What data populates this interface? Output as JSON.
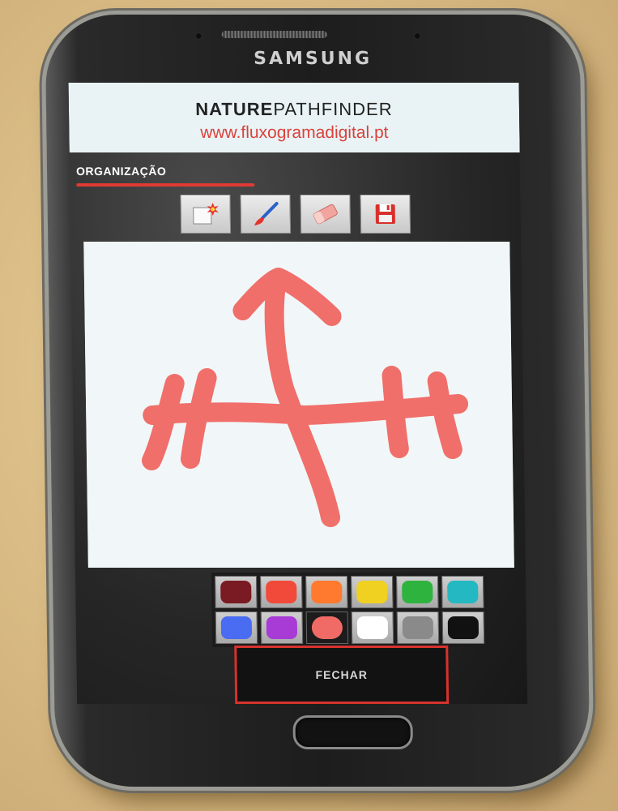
{
  "device": {
    "brand": "SAMSUNG"
  },
  "header": {
    "title_bold": "NATURE",
    "title_rest": "PATHFINDER",
    "url": "www.fluxogramadigital.pt"
  },
  "section": {
    "label": "ORGANIZAÇÃO"
  },
  "toolbar": {
    "tools": [
      {
        "icon": "new-canvas-icon"
      },
      {
        "icon": "brush-icon"
      },
      {
        "icon": "eraser-icon"
      },
      {
        "icon": "save-icon"
      }
    ]
  },
  "canvas": {
    "stroke_color": "#f06b66",
    "background": "#f1f7f8"
  },
  "palette": {
    "selected_index": 8,
    "colors": [
      "#7a1a22",
      "#f24a3a",
      "#ff7a2e",
      "#f0d020",
      "#2fb33f",
      "#23b8c2",
      "#4a6cf2",
      "#a83ad6",
      "#f06b66",
      "#ffffff",
      "#8a8a8a",
      "#111111"
    ]
  },
  "close_button": {
    "label": "FECHAR"
  },
  "theme": {
    "accent": "#e03a34"
  }
}
